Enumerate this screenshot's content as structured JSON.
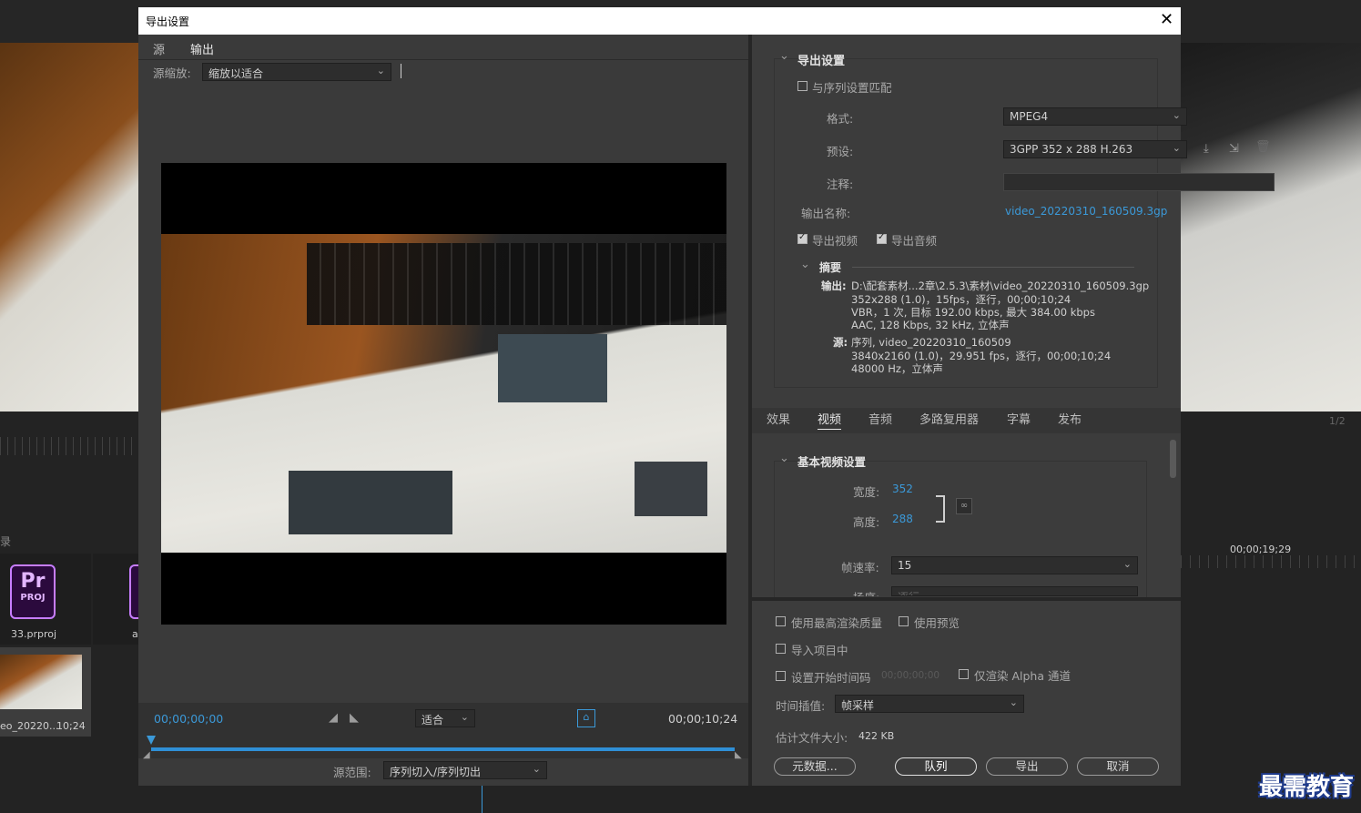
{
  "background_app": {
    "project_file": "33.prproj",
    "clip_name": "eo_20220...",
    "clip_duration": "10;24",
    "timecode_right": "00;00;19;29",
    "page_indicator": "1/2",
    "panel_label": "录",
    "pr_badge_top": "Pr",
    "pr_badge_bottom": "PROJ",
    "second_item_name": "a"
  },
  "dialog": {
    "title": "导出设置",
    "close_glyph": "✕"
  },
  "left": {
    "tabs": [
      {
        "label": "源"
      },
      {
        "label": "输出"
      }
    ],
    "source_scale_label": "源缩放:",
    "source_scale_value": "缩放以适合",
    "timecode_in": "00;00;00;00",
    "timecode_out": "00;00;10;24",
    "fit_value": "适合",
    "source_range_label": "源范围:",
    "source_range_value": "序列切入/序列切出"
  },
  "export_settings": {
    "section_title": "导出设置",
    "match_sequence_label": "与序列设置匹配",
    "format_label": "格式:",
    "format_value": "MPEG4",
    "preset_label": "预设:",
    "preset_value": "3GPP 352 x 288 H.263",
    "comment_label": "注释:",
    "comment_value": "",
    "output_name_label": "输出名称:",
    "output_name_value": "video_20220310_160509.3gp",
    "export_video_label": "导出视频",
    "export_audio_label": "导出音频",
    "summary_title": "摘要",
    "output_key": "输出:",
    "output_lines": [
      "D:\\配套素材...2章\\2.5.3\\素材\\video_20220310_160509.3gp",
      "352x288 (1.0)，15fps，逐行，00;00;10;24",
      "VBR，1 次, 目标 192.00 kbps, 最大 384.00 kbps",
      "AAC, 128 Kbps, 32 kHz, 立体声"
    ],
    "source_key": "源:",
    "source_lines": [
      "序列, video_20220310_160509",
      "3840x2160 (1.0)，29.951 fps，逐行，00;00;10;24",
      "48000 Hz，立体声"
    ]
  },
  "tabs": [
    {
      "label": "效果"
    },
    {
      "label": "视频"
    },
    {
      "label": "音频"
    },
    {
      "label": "多路复用器"
    },
    {
      "label": "字幕"
    },
    {
      "label": "发布"
    }
  ],
  "video": {
    "section_title": "基本视频设置",
    "width_label": "宽度:",
    "width_value": "352",
    "height_label": "高度:",
    "height_value": "288",
    "framerate_label": "帧速率:",
    "framerate_value": "15",
    "field_order_label": "场序:",
    "field_order_value": "逐行"
  },
  "bottom": {
    "max_render_quality": "使用最高渲染质量",
    "use_previews": "使用预览",
    "import_into_project": "导入项目中",
    "set_start_timecode": "设置开始时间码",
    "start_timecode_value": "00;00;00;00",
    "render_alpha_only": "仅渲染 Alpha 通道",
    "time_interpolation_label": "时间插值:",
    "time_interpolation_value": "帧采样",
    "estimated_size_label": "估计文件大小:",
    "estimated_size_value": "422 KB",
    "buttons": {
      "metadata": "元数据...",
      "queue": "队列",
      "export": "导出",
      "cancel": "取消"
    }
  },
  "watermark": "最需教育",
  "colors": {
    "accent": "#3b99d8",
    "panel": "#3a3a3a",
    "dark": "#232323"
  }
}
